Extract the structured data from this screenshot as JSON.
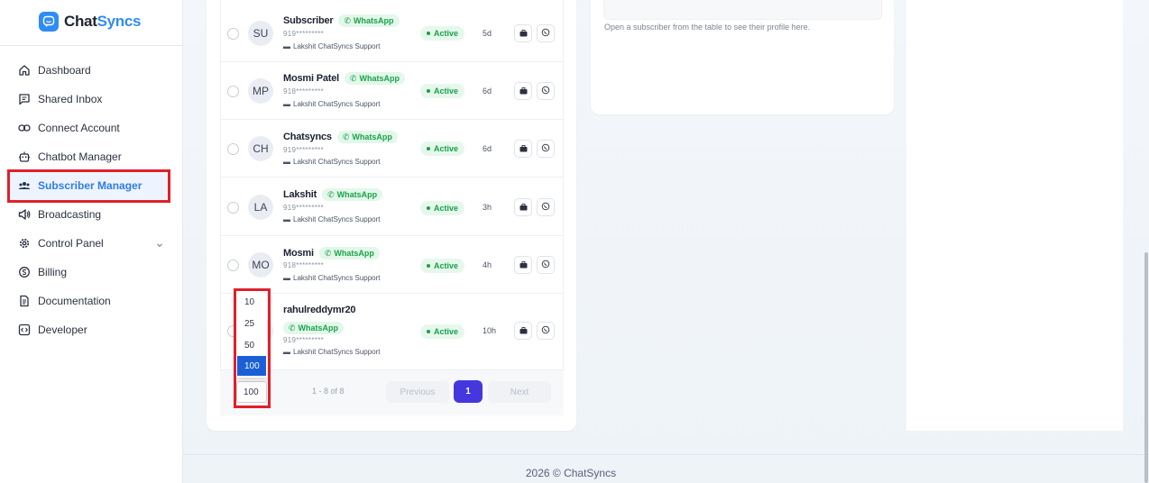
{
  "app": {
    "logo_part1": "Chat",
    "logo_part2": "Syncs",
    "brand_color": "#2f8cf4",
    "accent_color": "#4537de"
  },
  "sidebar": {
    "items": [
      {
        "label": "Dashboard",
        "icon": "home-icon"
      },
      {
        "label": "Shared Inbox",
        "icon": "chat-bubble-icon"
      },
      {
        "label": "Connect Account",
        "icon": "link-icon"
      },
      {
        "label": "Chatbot Manager",
        "icon": "bot-icon"
      },
      {
        "label": "Subscriber Manager",
        "icon": "users-icon",
        "active": true
      },
      {
        "label": "Broadcasting",
        "icon": "megaphone-icon"
      },
      {
        "label": "Control Panel",
        "icon": "gear-icon",
        "expandable": true
      },
      {
        "label": "Billing",
        "icon": "billing-icon"
      },
      {
        "label": "Documentation",
        "icon": "document-icon"
      },
      {
        "label": "Developer",
        "icon": "code-icon"
      }
    ]
  },
  "subscribers": [
    {
      "initials": "SU",
      "name": "Subscriber",
      "channel": "WhatsApp",
      "phone": "919*********",
      "agent": "Lakshit ChatSyncs Support",
      "status": "Active",
      "time": "5d"
    },
    {
      "initials": "MP",
      "name": "Mosmi Patel",
      "channel": "WhatsApp",
      "phone": "918*********",
      "agent": "Lakshit ChatSyncs Support",
      "status": "Active",
      "time": "6d"
    },
    {
      "initials": "CH",
      "name": "Chatsyncs",
      "channel": "WhatsApp",
      "phone": "919*********",
      "agent": "Lakshit ChatSyncs Support",
      "status": "Active",
      "time": "6d"
    },
    {
      "initials": "LA",
      "name": "Lakshit",
      "channel": "WhatsApp",
      "phone": "919*********",
      "agent": "Lakshit ChatSyncs Support",
      "status": "Active",
      "time": "3h"
    },
    {
      "initials": "MO",
      "name": "Mosmi",
      "channel": "WhatsApp",
      "phone": "918*********",
      "agent": "Lakshit ChatSyncs Support",
      "status": "Active",
      "time": "4h"
    },
    {
      "initials": "",
      "name": "rahulreddymr20",
      "channel": "WhatsApp",
      "phone": "919*********",
      "agent": "Lakshit ChatSyncs Support",
      "status": "Active",
      "time": "10h"
    }
  ],
  "pagination": {
    "range": "1 - 8 of 8",
    "previous": "Previous",
    "current_page": "1",
    "next": "Next",
    "per_page_selected": "100",
    "per_page_options": [
      "10",
      "25",
      "50",
      "100"
    ]
  },
  "profile": {
    "hint": "Open a subscriber from the table to see their profile here."
  },
  "footer": {
    "text": "2026 © ChatSyncs"
  }
}
